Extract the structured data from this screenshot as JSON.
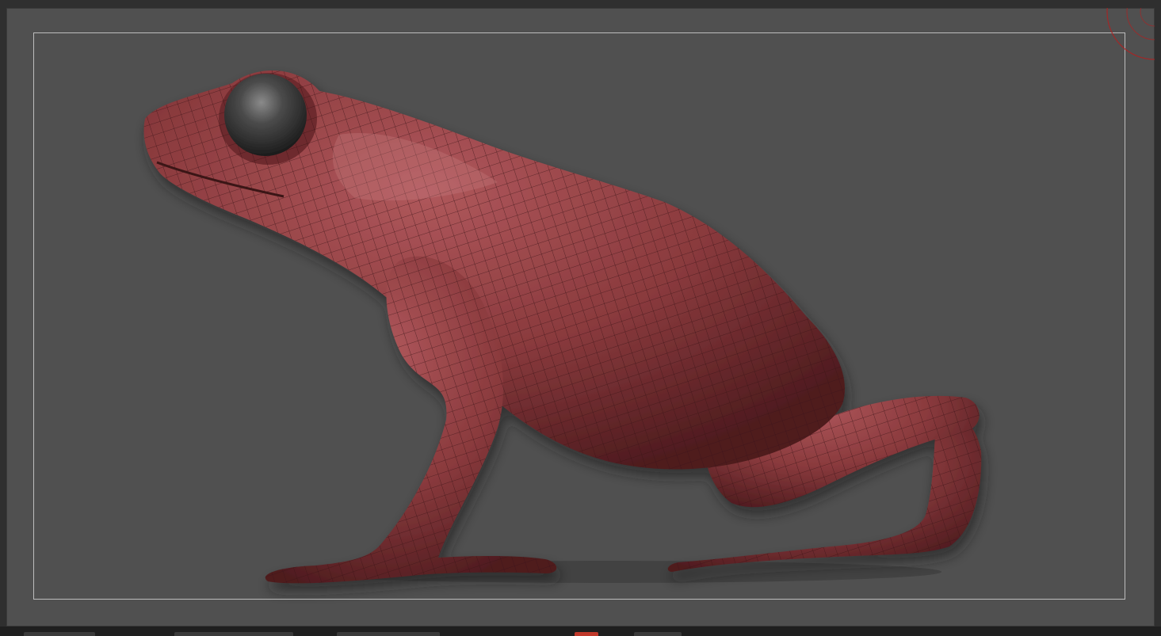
{
  "app": {
    "title": ""
  },
  "viewport": {
    "background_color": "#505050",
    "model": {
      "name": "frog",
      "wireframe": true,
      "skin_color": "#8a3a3d",
      "eye_color": "#3a3a3a"
    },
    "gizmo": {
      "icon": "navigation-gizmo-icon",
      "color": "#b02020"
    }
  },
  "footer": {
    "tabs": [
      "",
      "",
      "",
      "",
      ""
    ]
  }
}
